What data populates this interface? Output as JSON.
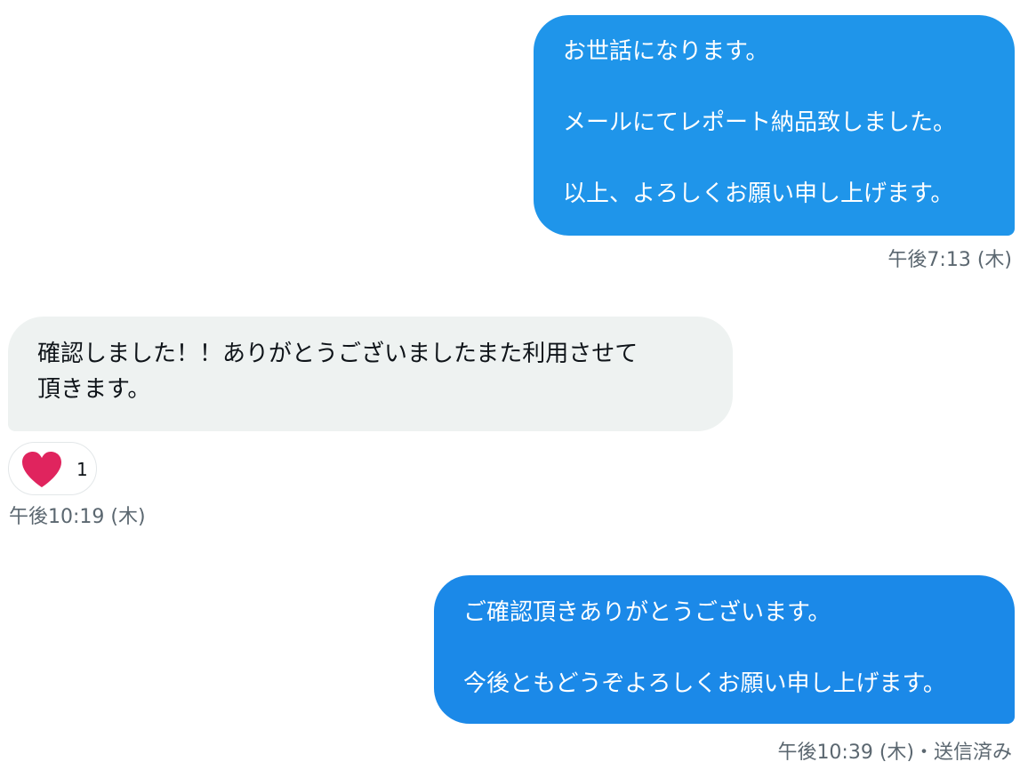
{
  "messages": [
    {
      "direction": "sent",
      "lines": [
        "お世話になります。",
        "",
        "メールにてレポート納品致しました。",
        "",
        "以上、よろしくお願い申し上げます。"
      ],
      "timestamp": "午後7:13 (木)"
    },
    {
      "direction": "received",
      "lines": [
        "確認しました！！ありがとうございましたまた利用させて",
        "頂きます。"
      ],
      "reaction": {
        "icon": "heart-icon",
        "count": "1",
        "color": "#e0245e"
      },
      "timestamp": "午後10:19 (木)"
    },
    {
      "direction": "sent",
      "lines": [
        "ご確認頂きありがとうございます。",
        "",
        "今後ともどうぞよろしくお願い申し上げます。"
      ],
      "timestamp": "午後10:39 (木)・送信済み"
    }
  ],
  "colors": {
    "sent_bubble_1": "#1f95ea",
    "sent_bubble_2": "#1b89e8",
    "received_bubble": "#eef2f1",
    "timestamp_text": "#5b6770"
  }
}
